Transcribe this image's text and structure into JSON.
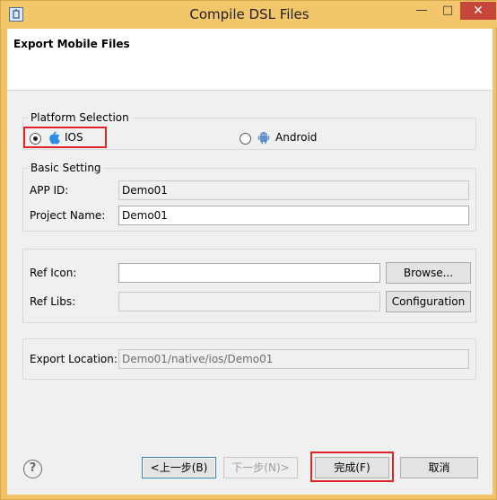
{
  "window": {
    "title": "Compile DSL Files",
    "minimize_glyph": "—",
    "maximize_glyph": "□",
    "close_glyph": "✕"
  },
  "header": {
    "title": "Export Mobile Files"
  },
  "platform": {
    "group_label": "Platform Selection",
    "options": [
      {
        "label": "IOS",
        "icon": "apple-icon",
        "selected": true
      },
      {
        "label": "Android",
        "icon": "android-icon",
        "selected": false
      }
    ]
  },
  "basic": {
    "group_label": "Basic Setting",
    "app_id_label": "APP ID:",
    "app_id_value": "Demo01",
    "project_name_label": "Project Name:",
    "project_name_value": "Demo01"
  },
  "refs": {
    "ref_icon_label": "Ref Icon:",
    "ref_icon_value": "",
    "browse_button": "Browse...",
    "ref_libs_label": "Ref Libs:",
    "ref_libs_value": "",
    "configuration_button": "Configuration"
  },
  "export": {
    "location_label": "Export Location:",
    "location_value": "Demo01/native/ios/Demo01"
  },
  "footer": {
    "help_glyph": "?",
    "back_button": "<上一步(B)",
    "next_button": "下一步(N)>",
    "finish_button": "完成(F)",
    "cancel_button": "取消"
  },
  "colors": {
    "highlight": "#e0242b",
    "title_bar": "#f3c66b",
    "close_button": "#c7463a"
  }
}
